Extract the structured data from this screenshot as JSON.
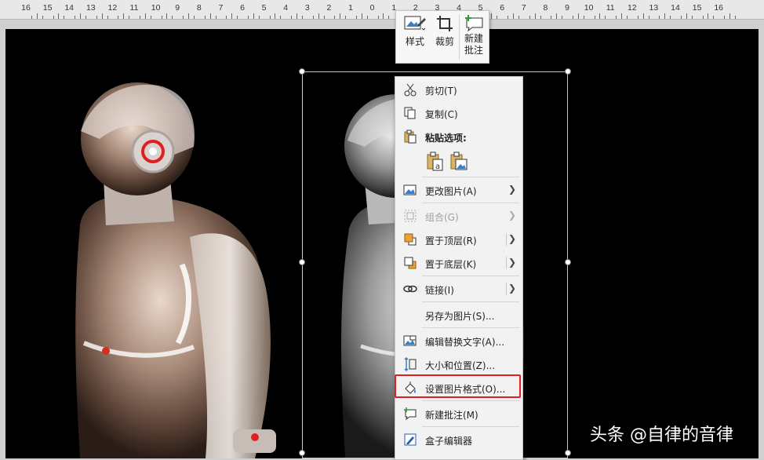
{
  "ruler": {
    "labels": [
      "16",
      "15",
      "14",
      "13",
      "12",
      "11",
      "10",
      "9",
      "8",
      "7",
      "6",
      "5",
      "4",
      "3",
      "2",
      "1",
      "0",
      "1",
      "2",
      "3",
      "4",
      "5",
      "6",
      "7",
      "8",
      "9",
      "10",
      "11",
      "12",
      "13",
      "14",
      "15",
      "16"
    ]
  },
  "mini_toolbar": {
    "style_label": "样式",
    "crop_label": "裁剪",
    "new_comment_line1": "新建",
    "new_comment_line2": "批注"
  },
  "context_menu": {
    "cut": "剪切(T)",
    "copy": "复制(C)",
    "paste_options": "粘贴选项:",
    "change_picture": "更改图片(A)",
    "group": "组合(G)",
    "bring_to_front": "置于顶层(R)",
    "send_to_back": "置于底层(K)",
    "link": "链接(I)",
    "save_as_picture": "另存为图片(S)...",
    "edit_alt_text": "编辑替换文字(A)...",
    "size_and_position": "大小和位置(Z)...",
    "format_picture": "设置图片格式(O)...",
    "new_comment": "新建批注(M)",
    "box_editor": "盒子编辑器"
  },
  "watermark": "头条 @自律的音律",
  "colors": {
    "highlight_border": "#e02020",
    "menu_bg": "#f2f2f2",
    "slide_bg": "#000000"
  }
}
